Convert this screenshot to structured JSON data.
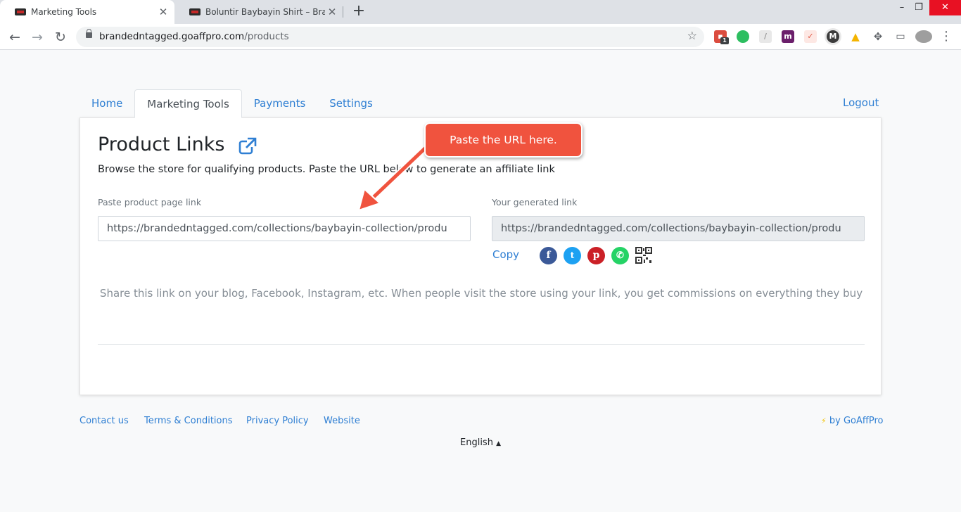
{
  "browser": {
    "tabs": [
      {
        "title": "Marketing Tools",
        "active": true
      },
      {
        "title": "Boluntir Baybayin Shirt – Brande",
        "active": false
      }
    ],
    "url_host": "brandedntagged.goaffpro.com",
    "url_path": "/products",
    "window_controls": {
      "minimize": "–",
      "maximize": "❐",
      "close": "✕"
    },
    "extensions": [
      "todoist-icon",
      "evernote-icon",
      "feather-icon",
      "mail-icon",
      "bookmark-icon",
      "m-icon",
      "drive-icon",
      "puzzle-icon",
      "cast-icon",
      "profile-icon"
    ]
  },
  "nav": {
    "tabs": [
      "Home",
      "Marketing Tools",
      "Payments",
      "Settings"
    ],
    "active_tab": "Marketing Tools",
    "logout": "Logout"
  },
  "card": {
    "title": "Product Links",
    "subtitle": "Browse the store for qualifying products. Paste the URL below to generate an affiliate link",
    "product_link_label": "Paste product page link",
    "product_link_value": "https://brandedntagged.com/collections/baybayin-collection/produ",
    "generated_link_label": "Your generated link",
    "generated_link_value": "https://brandedntagged.com/collections/baybayin-collection/produ",
    "copy_label": "Copy",
    "share_icons": [
      "facebook-icon",
      "twitter-icon",
      "pinterest-icon",
      "whatsapp-icon",
      "qr-code-icon"
    ],
    "help_text": "Share this link on your blog, Facebook, Instagram, etc. When people visit the store using your link, you get commissions on everything they buy"
  },
  "annotation": {
    "callout_text": "Paste the URL here."
  },
  "footer": {
    "links": [
      "Contact us",
      "Terms & Conditions",
      "Privacy Policy",
      "Website"
    ],
    "language": "English",
    "powered_by": "by GoAffPro"
  },
  "colors": {
    "link": "#2f7fd3",
    "callout": "#f0533e",
    "facebook": "#3b5998",
    "twitter": "#1da1f2",
    "pinterest": "#cb2027",
    "whatsapp": "#25d366"
  }
}
